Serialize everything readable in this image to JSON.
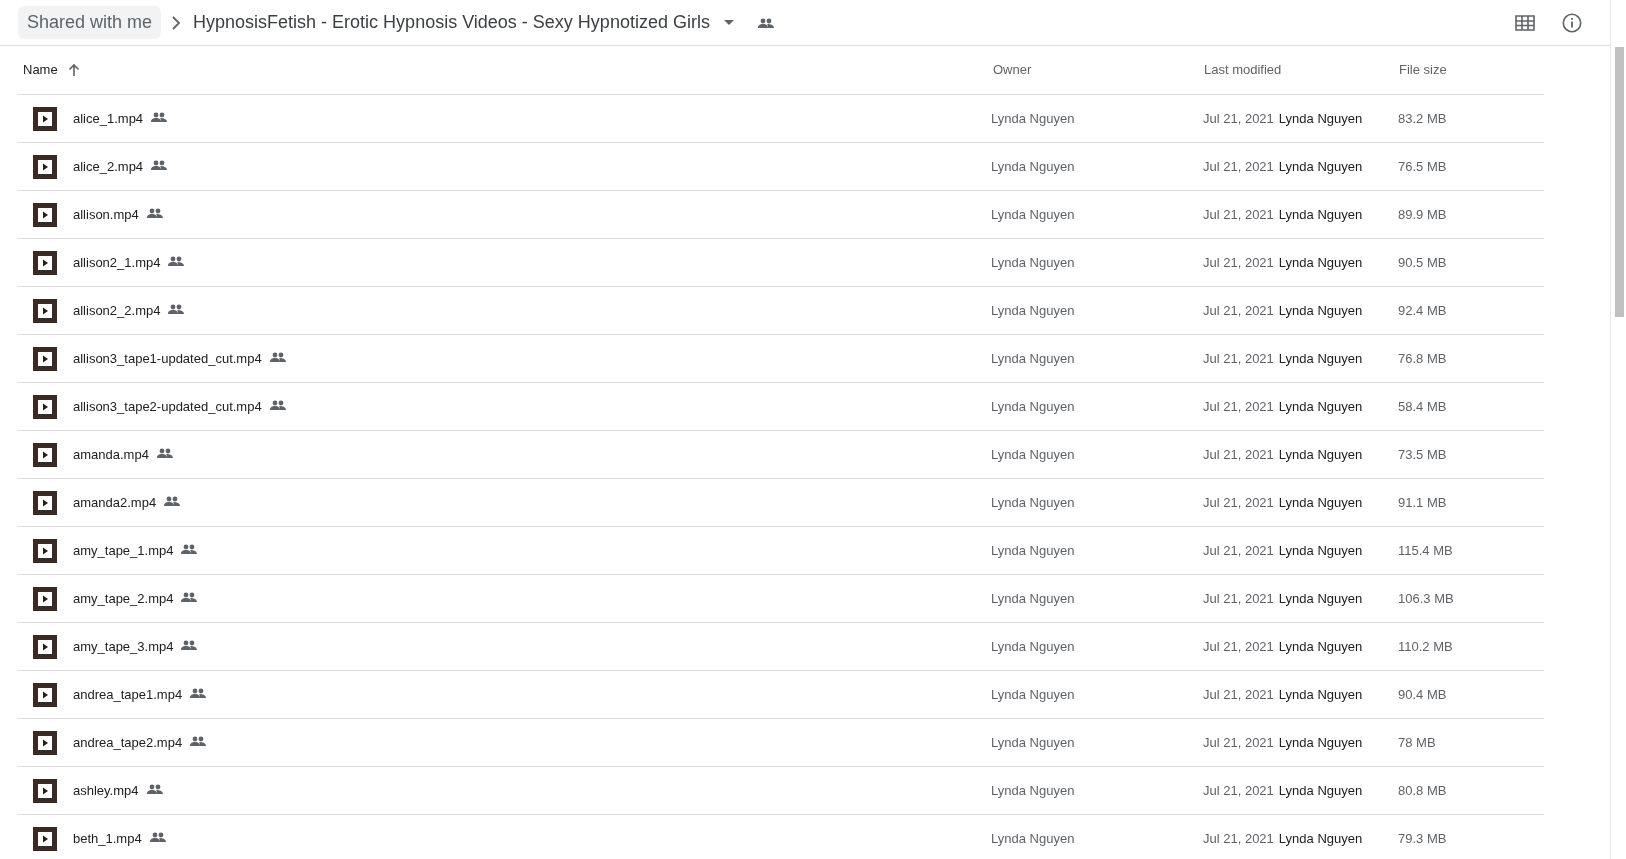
{
  "breadcrumb": {
    "root": "Shared with me",
    "folder": "HypnosisFetish - Erotic Hypnosis Videos - Sexy Hypnotized Girls"
  },
  "table": {
    "columns": [
      {
        "label": "Name",
        "sorted": true
      },
      {
        "label": "Owner",
        "sorted": false
      },
      {
        "label": "Last modified",
        "sorted": false
      },
      {
        "label": "File size",
        "sorted": false
      }
    ],
    "rows": [
      {
        "name": "alice_1.mp4",
        "shared": true,
        "owner": "Lynda Nguyen",
        "modified": "Jul 21, 2021",
        "modified_by": "Lynda Nguyen",
        "size": "83.2 MB"
      },
      {
        "name": "alice_2.mp4",
        "shared": true,
        "owner": "Lynda Nguyen",
        "modified": "Jul 21, 2021",
        "modified_by": "Lynda Nguyen",
        "size": "76.5 MB"
      },
      {
        "name": "allison.mp4",
        "shared": true,
        "owner": "Lynda Nguyen",
        "modified": "Jul 21, 2021",
        "modified_by": "Lynda Nguyen",
        "size": "89.9 MB"
      },
      {
        "name": "allison2_1.mp4",
        "shared": true,
        "owner": "Lynda Nguyen",
        "modified": "Jul 21, 2021",
        "modified_by": "Lynda Nguyen",
        "size": "90.5 MB"
      },
      {
        "name": "allison2_2.mp4",
        "shared": true,
        "owner": "Lynda Nguyen",
        "modified": "Jul 21, 2021",
        "modified_by": "Lynda Nguyen",
        "size": "92.4 MB"
      },
      {
        "name": "allison3_tape1-updated_cut.mp4",
        "shared": true,
        "owner": "Lynda Nguyen",
        "modified": "Jul 21, 2021",
        "modified_by": "Lynda Nguyen",
        "size": "76.8 MB"
      },
      {
        "name": "allison3_tape2-updated_cut.mp4",
        "shared": true,
        "owner": "Lynda Nguyen",
        "modified": "Jul 21, 2021",
        "modified_by": "Lynda Nguyen",
        "size": "58.4 MB"
      },
      {
        "name": "amanda.mp4",
        "shared": true,
        "owner": "Lynda Nguyen",
        "modified": "Jul 21, 2021",
        "modified_by": "Lynda Nguyen",
        "size": "73.5 MB"
      },
      {
        "name": "amanda2.mp4",
        "shared": true,
        "owner": "Lynda Nguyen",
        "modified": "Jul 21, 2021",
        "modified_by": "Lynda Nguyen",
        "size": "91.1 MB"
      },
      {
        "name": "amy_tape_1.mp4",
        "shared": true,
        "owner": "Lynda Nguyen",
        "modified": "Jul 21, 2021",
        "modified_by": "Lynda Nguyen",
        "size": "115.4 MB"
      },
      {
        "name": "amy_tape_2.mp4",
        "shared": true,
        "owner": "Lynda Nguyen",
        "modified": "Jul 21, 2021",
        "modified_by": "Lynda Nguyen",
        "size": "106.3 MB"
      },
      {
        "name": "amy_tape_3.mp4",
        "shared": true,
        "owner": "Lynda Nguyen",
        "modified": "Jul 21, 2021",
        "modified_by": "Lynda Nguyen",
        "size": "110.2 MB"
      },
      {
        "name": "andrea_tape1.mp4",
        "shared": true,
        "owner": "Lynda Nguyen",
        "modified": "Jul 21, 2021",
        "modified_by": "Lynda Nguyen",
        "size": "90.4 MB"
      },
      {
        "name": "andrea_tape2.mp4",
        "shared": true,
        "owner": "Lynda Nguyen",
        "modified": "Jul 21, 2021",
        "modified_by": "Lynda Nguyen",
        "size": "78 MB"
      },
      {
        "name": "ashley.mp4",
        "shared": true,
        "owner": "Lynda Nguyen",
        "modified": "Jul 21, 2021",
        "modified_by": "Lynda Nguyen",
        "size": "80.8 MB"
      },
      {
        "name": "beth_1.mp4",
        "shared": true,
        "owner": "Lynda Nguyen",
        "modified": "Jul 21, 2021",
        "modified_by": "Lynda Nguyen",
        "size": "79.3 MB"
      }
    ]
  }
}
